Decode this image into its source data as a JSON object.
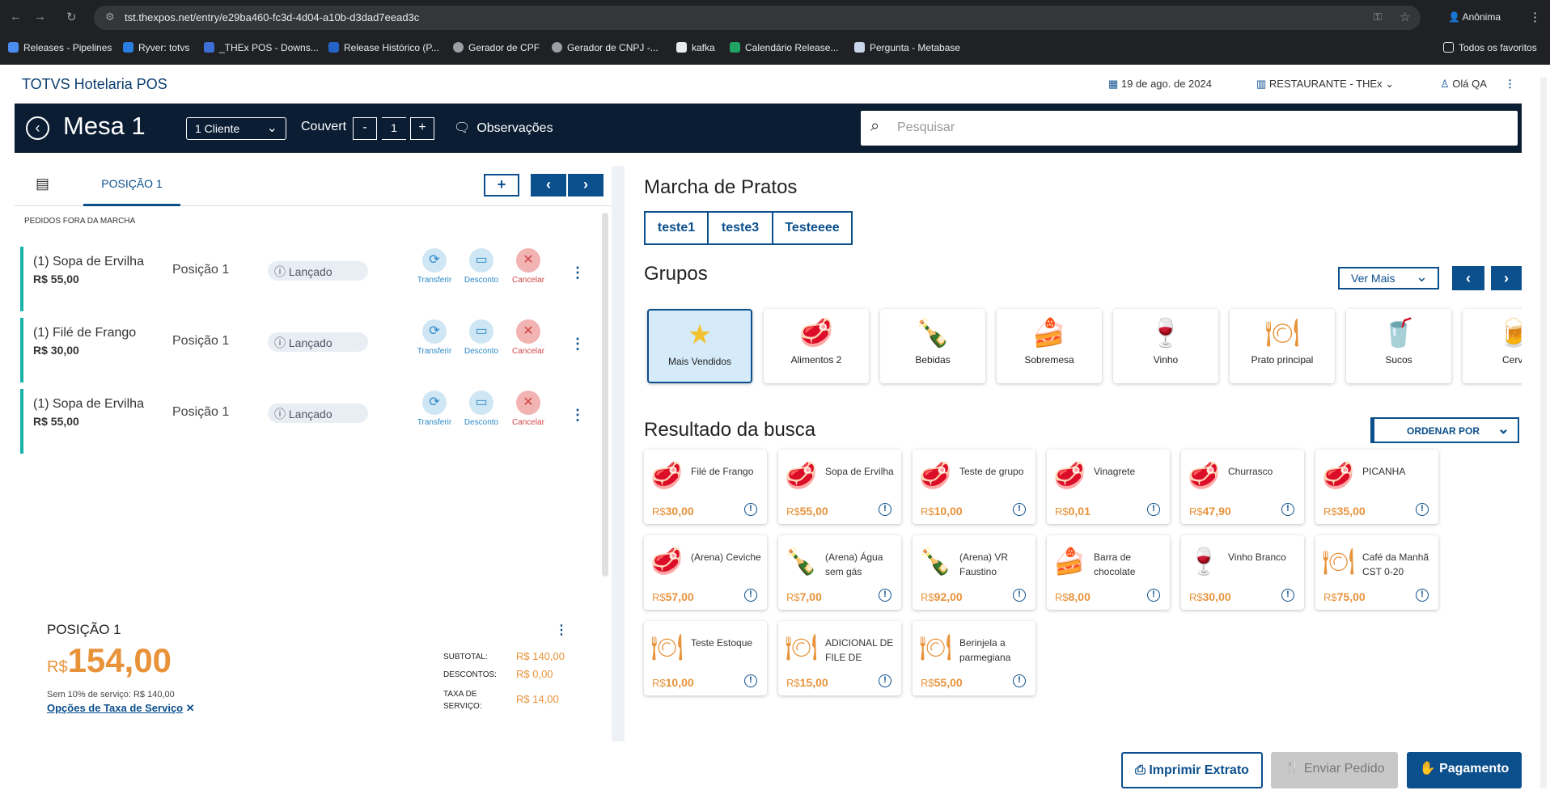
{
  "browser": {
    "url": "tst.thexpos.net/entry/e29ba460-fc3d-4d04-a10b-d3dad7eead3c",
    "profile": "Anônima",
    "bookmarks": [
      "Releases - Pipelines",
      "Ryver: totvs",
      "_THEx POS - Downs...",
      "Release Histórico (P...",
      "Gerador de CPF",
      "Gerador de CNPJ -...",
      "kafka",
      "Calendário Release...",
      "Pergunta - Metabase"
    ],
    "all_bookmarks": "Todos os favoritos"
  },
  "app": {
    "title": "TOTVS Hotelaria POS",
    "date": "19 de ago. de 2024",
    "store": "RESTAURANTE - THEx",
    "user": "Olá QA"
  },
  "bar": {
    "mesa": "Mesa 1",
    "clientes": "1 Cliente",
    "couvert_label": "Couvert",
    "couvert_minus": "-",
    "couvert_value": "1",
    "couvert_plus": "+",
    "observacoes": "Observações",
    "search_placeholder": "Pesquisar"
  },
  "left": {
    "tab_label": "POSIÇÃO 1",
    "add": "+",
    "prev": "‹",
    "next": "›",
    "section": "PEDIDOS FORA DA MARCHA",
    "orders": [
      {
        "name": "(1)  Sopa de Ervilha",
        "price": "R$ 55,00",
        "pos": "Posição 1",
        "status": "Lançado"
      },
      {
        "name": "(1)  Filé de Frango",
        "price": "R$ 30,00",
        "pos": "Posição 1",
        "status": "Lançado"
      },
      {
        "name": "(1)  Sopa de Ervilha",
        "price": "R$ 55,00",
        "pos": "Posição 1",
        "status": "Lançado"
      }
    ],
    "actions": {
      "transfer": "Transferir",
      "discount": "Desconto",
      "cancel": "Cancelar"
    }
  },
  "totals": {
    "title": "POSIÇÃO 1",
    "currency": "R$",
    "total": "154,00",
    "note": "Sem 10% de serviço: R$ 140,00",
    "service_link": "Opções de Taxa de Serviço",
    "subtotal_label": "SUBTOTAL:",
    "subtotal": "R$ 140,00",
    "discount_label": "DESCONTOS:",
    "discount": "R$ 0,00",
    "tax_label_1": "TAXA DE",
    "tax_label_2": "SERVIÇO:",
    "tax": "R$ 14,00"
  },
  "marcha": {
    "title": "Marcha de Pratos",
    "tabs": [
      "teste1",
      "teste3",
      "Testeeee"
    ]
  },
  "grupos": {
    "title": "Grupos",
    "ver_mais": "Ver Mais",
    "items": [
      {
        "label": "Mais Vendidos",
        "icon": "star-icon"
      },
      {
        "label": "Alimentos 2",
        "icon": "steak-icon"
      },
      {
        "label": "Bebidas",
        "icon": "bottle-icon"
      },
      {
        "label": "Sobremesa",
        "icon": "cake-icon"
      },
      {
        "label": "Vinho",
        "icon": "wine-icon"
      },
      {
        "label": "Prato principal",
        "icon": "cloche-icon"
      },
      {
        "label": "Sucos",
        "icon": "juice-icon"
      },
      {
        "label": "Cerve",
        "icon": "beer-icon"
      }
    ]
  },
  "resultado": {
    "title": "Resultado da busca",
    "order_by": "ORDENAR POR",
    "currency": "R$",
    "products": [
      {
        "name": "Filé de Frango",
        "price": "30,00",
        "icon": "steak-icon"
      },
      {
        "name": "Sopa de Ervilha",
        "price": "55,00",
        "icon": "steak-icon"
      },
      {
        "name": "Teste de grupo",
        "price": "10,00",
        "icon": "steak-icon"
      },
      {
        "name": "Vinagrete",
        "price": "0,01",
        "icon": "steak-icon"
      },
      {
        "name": "Churrasco",
        "price": "47,90",
        "icon": "steak-icon"
      },
      {
        "name": "PICANHA",
        "price": "35,00",
        "icon": "steak-icon"
      },
      {
        "name": "(Arena) Ceviche",
        "price": "57,00",
        "icon": "steak-icon"
      },
      {
        "name": "(Arena) Água sem gás",
        "price": "7,00",
        "icon": "bottle-icon"
      },
      {
        "name": "(Arena) VR Faustino",
        "price": "92,00",
        "icon": "bottle-icon"
      },
      {
        "name": "Barra de chocolate",
        "price": "8,00",
        "icon": "cake-icon"
      },
      {
        "name": "Vinho Branco",
        "price": "30,00",
        "icon": "wine-icon"
      },
      {
        "name": "Café da Manhã CST 0-20",
        "price": "75,00",
        "icon": "cloche-icon"
      },
      {
        "name": "Teste Estoque",
        "price": "10,00",
        "icon": "cloche-icon"
      },
      {
        "name": "ADICIONAL DE FILE DE",
        "price": "15,00",
        "icon": "cloche-icon"
      },
      {
        "name": "Berinjela a parmegiana",
        "price": "55,00",
        "icon": "cloche-icon"
      }
    ]
  },
  "footer": {
    "print": "Imprimir Extrato",
    "send": "Enviar Pedido",
    "pay": "Pagamento"
  },
  "colors": {
    "primary": "#0b4f8c",
    "dark": "#0a1d33",
    "accent": "#e8923a",
    "teal": "#1ab2a8"
  }
}
